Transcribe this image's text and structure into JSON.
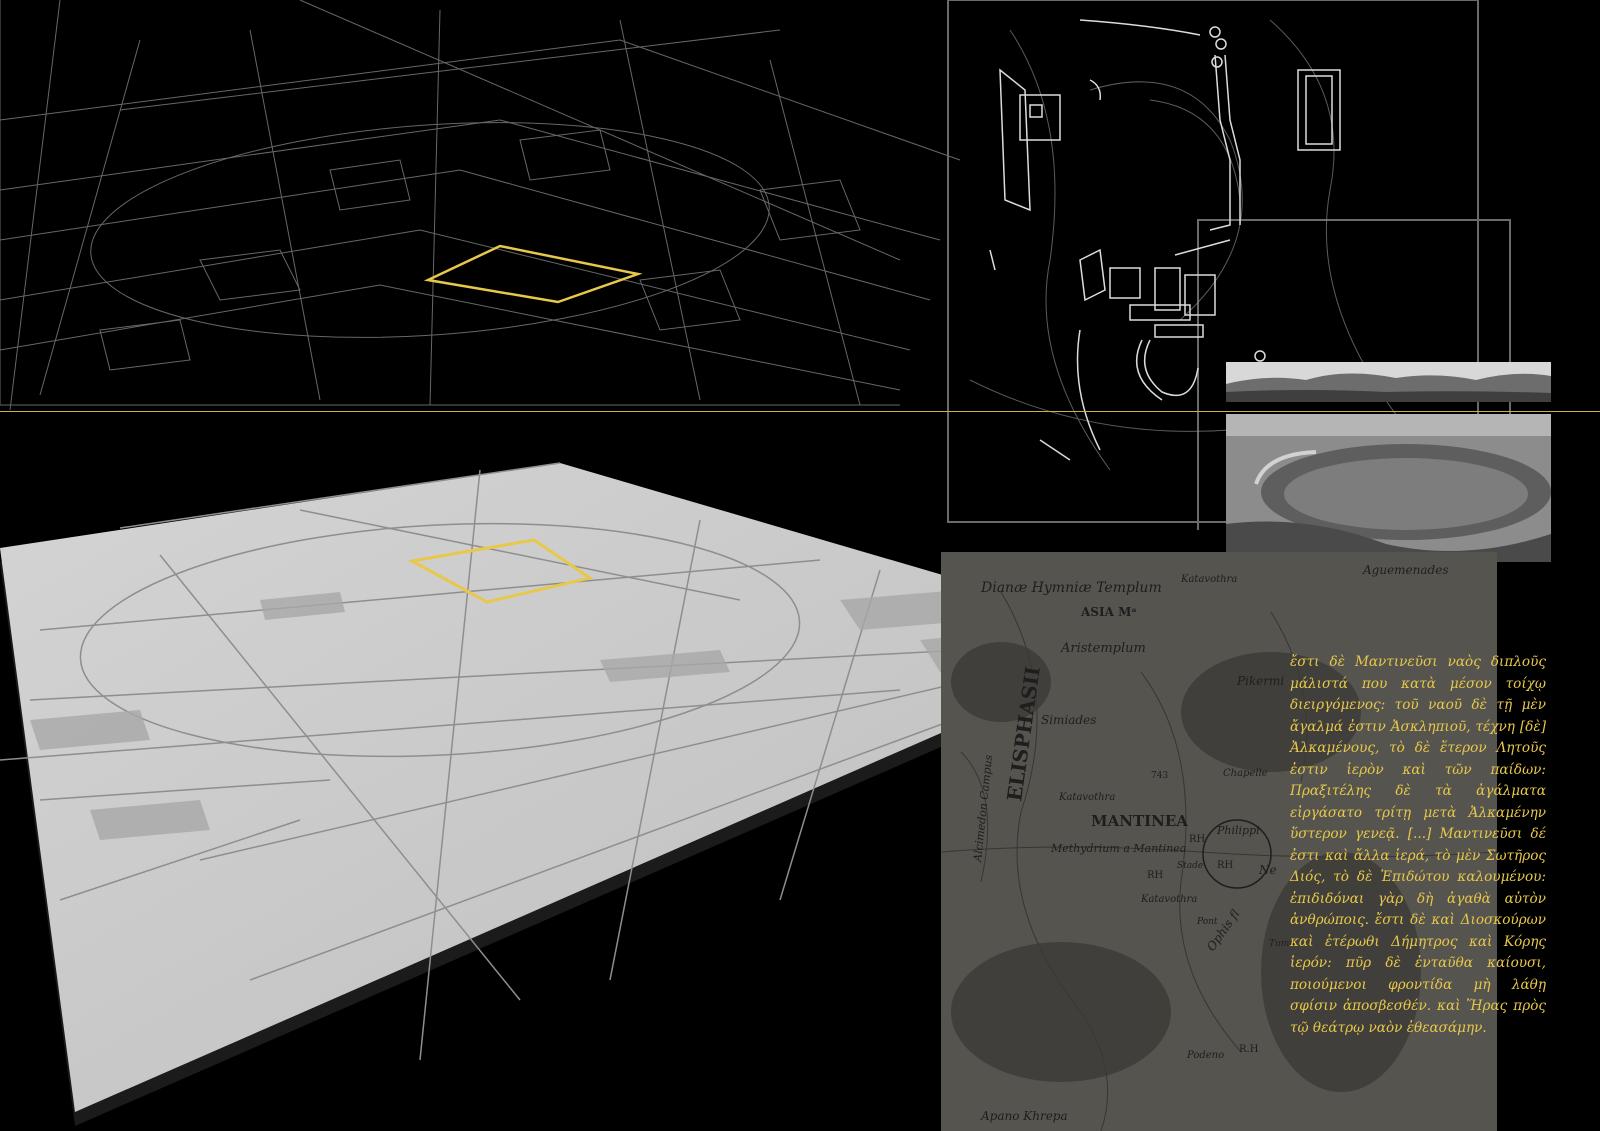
{
  "colors": {
    "background": "#000000",
    "accent_yellow": "#e8c84a",
    "wireframe_line": "#8a8a8a",
    "model_surface": "#c9c9c9",
    "frame_gray": "#6a6a6a"
  },
  "map": {
    "labels": {
      "diana_temple": "Dianæ Hymniæ Templum",
      "katavothra_top": "Katavothra",
      "asia": "ASIA Mᵃ",
      "aristemplum": "Aristemplum",
      "pikermi": "Pikermi",
      "simiades": "Simiades",
      "chapelle": "Chapelle",
      "elevation": "743",
      "katavothra_mid": "Katavothra",
      "mantinea": "MANTINEA",
      "rh_1": "RH",
      "philippi": "Philippi",
      "methydrium": "Methydrium a Mantinea",
      "stade": "Stade",
      "rh_2": "RH",
      "rh_3": "RH",
      "katavothra_low": "Katavothra",
      "elisphasii": "ELISPHASII",
      "campus": "Alcimedon Campus",
      "ophis": "Ophis fl",
      "pont": "Pont",
      "tumu": "Tumu",
      "podeno": "Podeno",
      "rh_4": "R.H",
      "kakr": "Apano Khrepa",
      "ne": "Ne",
      "aguemenades": "Aguemenades"
    }
  },
  "quote": {
    "text": "ἔστι δὲ Μαντινεῦσι ναὸς διπλοῦς μάλιστά που κατὰ μέσον τοίχῳ διειργόμενος: τοῦ ναοῦ δὲ τῇ μὲν ἄγαλμά ἐστιν Ἀσκληπιοῦ, τέχνη [δὲ] Ἀλκαμένους, τὸ δὲ ἕτερον Λητοῦς ἐστιν ἱερὸν καὶ τῶν παίδων: Πραξιτέλης δὲ τὰ ἀγάλματα εἰργάσατο τρίτῃ μετὰ Ἀλκαμένην ὕστερον γενεᾷ. [...] Μαντινεῦσι δέ ἐστι καὶ ἄλλα ἱερά, τὸ μὲν Σωτῆρος Διός, τὸ δὲ Ἐπιδώτου καλουμένου: ἐπιδιδόναι γὰρ δὴ ἀγαθὰ αὐτὸν ἀνθρώποις. ἔστι δὲ καὶ Διοσκούρων καὶ ἑτέρωθι Δήμητρος καὶ Κόρης ἱερόν: πῦρ δὲ ἐνταῦθα καίουσι, ποιούμενοι φροντίδα μὴ λάθῃ σφίσιν ἀποσβεσθέν. καὶ Ἥρας πρὸς τῷ θεάτρῳ ναὸν ἐθεασάμην."
  }
}
